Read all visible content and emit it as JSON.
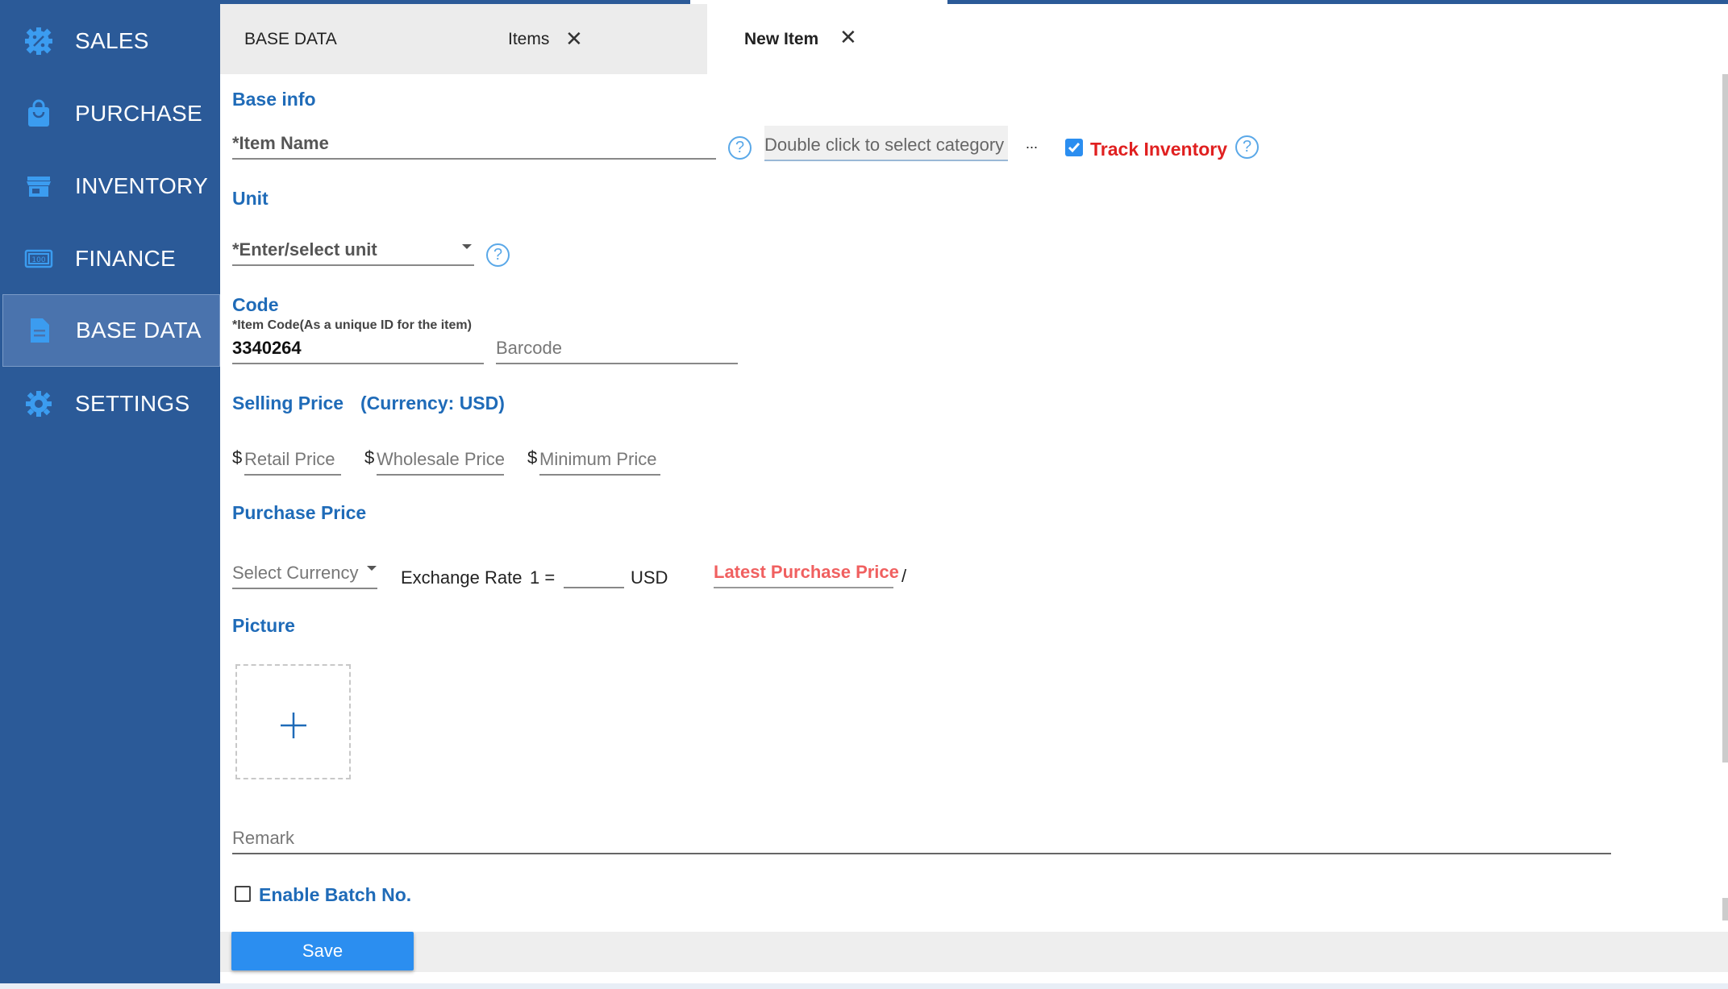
{
  "sidebar": {
    "items": [
      {
        "label": "SALES",
        "icon": "sales-gear-percent-icon"
      },
      {
        "label": "PURCHASE",
        "icon": "shopping-bag-icon"
      },
      {
        "label": "INVENTORY",
        "icon": "store-icon"
      },
      {
        "label": "FINANCE",
        "icon": "money-icon"
      },
      {
        "label": "BASE DATA",
        "icon": "document-icon",
        "active": true
      },
      {
        "label": "SETTINGS",
        "icon": "gear-icon"
      }
    ]
  },
  "tabs": {
    "base": "BASE DATA",
    "items": "Items",
    "new_item": "New Item",
    "close_glyph": "✕"
  },
  "base_info": {
    "title": "Base info",
    "item_name_placeholder": "*Item Name",
    "category_placeholder": "Double click to select category",
    "ellipsis": "...",
    "track_inventory_label": "Track Inventory",
    "track_inventory_checked": true,
    "help": "?"
  },
  "unit": {
    "title": "Unit",
    "placeholder": "*Enter/select unit"
  },
  "code": {
    "title": "Code",
    "item_code_label": "*Item Code(As a unique ID for the item)",
    "item_code_value": "3340264",
    "barcode_placeholder": "Barcode"
  },
  "selling_price": {
    "title": "Selling Price",
    "currency_note": "(Currency: USD)",
    "currency_symbol": "$",
    "retail_placeholder": "Retail Price",
    "wholesale_placeholder": "Wholesale Price",
    "minimum_placeholder": "Minimum Price"
  },
  "purchase_price": {
    "title": "Purchase Price",
    "select_currency_placeholder": "Select Currency",
    "exchange_rate_label": "Exchange Rate",
    "exchange_prefix": "1 =",
    "exchange_unit": "USD",
    "latest_price_label": "Latest Purchase Price",
    "slash": "/"
  },
  "picture": {
    "title": "Picture"
  },
  "remark": {
    "placeholder": "Remark"
  },
  "batch": {
    "label": "Enable Batch No.",
    "checked": false
  },
  "actions": {
    "save_label": "Save"
  },
  "colors": {
    "sidebar": "#2b5a98",
    "accent": "#1f6bb8",
    "danger": "#e02020",
    "latest_price": "#f06060",
    "save_button": "#2b8ef0"
  }
}
